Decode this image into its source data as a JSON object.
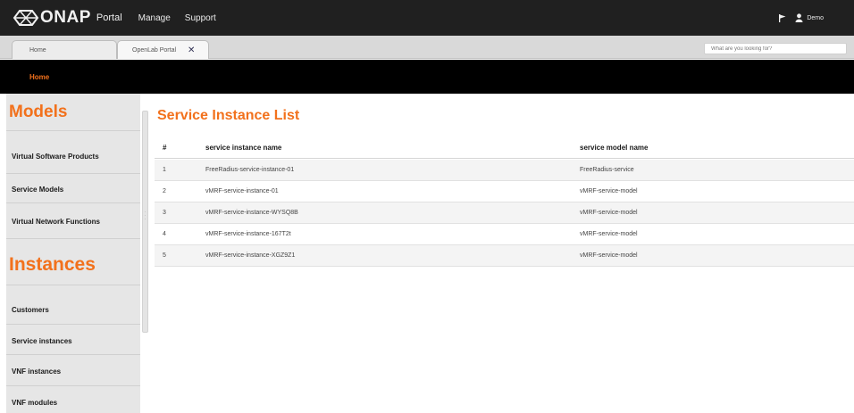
{
  "header": {
    "logo_text": "ONAP",
    "logo_sub": "Portal",
    "nav": [
      "Manage",
      "Support"
    ],
    "user_name": "Demo"
  },
  "tabs": [
    {
      "label": "Home"
    },
    {
      "label": "OpenLab Portal",
      "close": "✕"
    }
  ],
  "search": {
    "placeholder": "What are you looking for?"
  },
  "homebar": {
    "link": "Home"
  },
  "sidebar": {
    "models_heading": "Models",
    "models": [
      "Virtual Software Products",
      "Service Models",
      "Virtual Network Functions"
    ],
    "instances_heading": "Instances",
    "instances": [
      "Customers",
      "Service instances",
      "VNF instances",
      "VNF modules"
    ]
  },
  "main": {
    "title": "Service Instance List",
    "columns": [
      "#",
      "service instance name",
      "service model name"
    ],
    "rows": [
      {
        "num": "1",
        "name": "FreeRadius-service-instance-01",
        "model": "FreeRadius-service"
      },
      {
        "num": "2",
        "name": "vMRF-service-instance-01",
        "model": "vMRF-service-model"
      },
      {
        "num": "3",
        "name": "vMRF-service-instance-WYSQ8B",
        "model": "vMRF-service-model"
      },
      {
        "num": "4",
        "name": "vMRF-service-instance-167T2t",
        "model": "vMRF-service-model"
      },
      {
        "num": "5",
        "name": "vMRF-service-instance-XGZ9Z1",
        "model": "vMRF-service-model"
      }
    ]
  },
  "colors": {
    "accent": "#f2711c",
    "header_bg": "#202020",
    "homebar_bg": "#000000",
    "sidebar_bg": "#e6e6e6"
  }
}
